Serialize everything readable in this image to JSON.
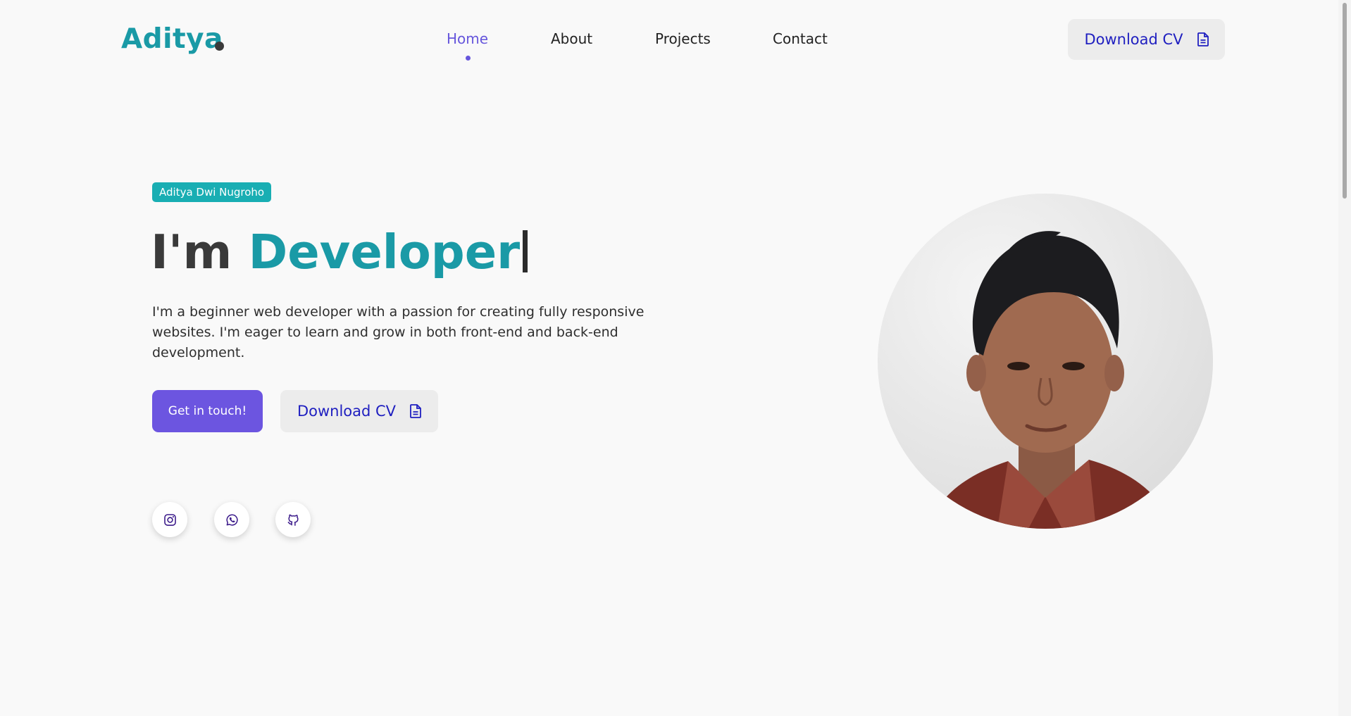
{
  "header": {
    "logo_text": "Aditya",
    "nav": [
      {
        "label": "Home",
        "active": true
      },
      {
        "label": "About",
        "active": false
      },
      {
        "label": "Projects",
        "active": false
      },
      {
        "label": "Contact",
        "active": false
      }
    ],
    "download_cv_label": "Download CV",
    "download_cv_icon": "document-icon"
  },
  "hero": {
    "badge": "Aditya Dwi Nugroho",
    "title_prefix": "I'm",
    "title_highlight": "Developer",
    "description": "I'm a beginner web developer with a passion for creating fully responsive websites. I'm eager to learn and grow in both front-end and back-end development.",
    "cta_primary_label": "Get in touch!",
    "cta_secondary_label": "Download CV",
    "socials": [
      {
        "name": "instagram",
        "icon": "instagram-icon"
      },
      {
        "name": "whatsapp",
        "icon": "whatsapp-icon"
      },
      {
        "name": "github",
        "icon": "github-icon"
      }
    ],
    "portrait_image": "profile-photo"
  },
  "colors": {
    "brand_teal": "#1a9aa6",
    "badge_teal": "#19aeb3",
    "primary_purple": "#6c55e0",
    "nav_active": "#6656dc",
    "link_blue": "#1f1fc0",
    "background": "#f9f9f9"
  }
}
